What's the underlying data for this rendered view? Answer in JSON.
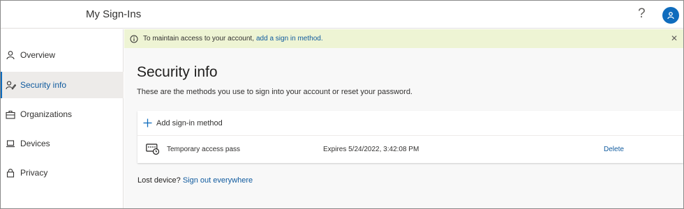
{
  "header": {
    "app_title": "My Sign-Ins",
    "help_glyph": "?"
  },
  "sidebar": {
    "items": [
      {
        "label": "Overview",
        "icon": "person-icon",
        "active": false
      },
      {
        "label": "Security info",
        "icon": "security-info-icon",
        "active": true
      },
      {
        "label": "Organizations",
        "icon": "briefcase-icon",
        "active": false
      },
      {
        "label": "Devices",
        "icon": "laptop-icon",
        "active": false
      },
      {
        "label": "Privacy",
        "icon": "lock-icon",
        "active": false
      }
    ]
  },
  "banner": {
    "text": "To maintain access to your account,",
    "link": "add a sign in method.",
    "close_glyph": "✕"
  },
  "main": {
    "title": "Security info",
    "subtitle": "These are the methods you use to sign into your account or reset your password.",
    "add_method_label": "Add sign-in method",
    "methods": [
      {
        "name": "Temporary access pass",
        "expires": "Expires 5/24/2022, 3:42:08 PM",
        "action": "Delete"
      }
    ],
    "lost_device_label": "Lost device?",
    "sign_out_link": "Sign out everywhere"
  },
  "colors": {
    "accent": "#0f6cbd",
    "link": "#0f5a9e",
    "banner_bg": "#eef4d4",
    "active_nav_bg": "#edebe9",
    "main_bg": "#f8f8f8"
  }
}
